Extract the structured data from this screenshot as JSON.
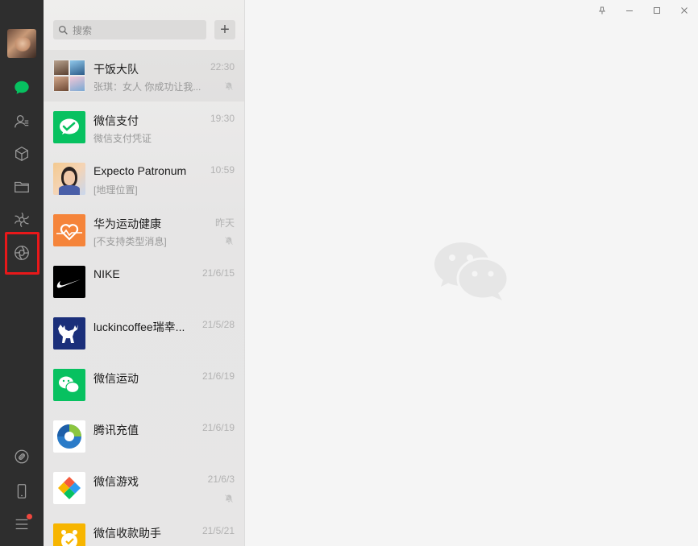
{
  "search": {
    "placeholder": "搜索",
    "add_label": "+"
  },
  "nav": {
    "items": [
      {
        "icon": "chat-bubble-icon",
        "active": true
      },
      {
        "icon": "contacts-icon"
      },
      {
        "icon": "cube-icon"
      },
      {
        "icon": "folder-icon"
      },
      {
        "icon": "moments-icon"
      },
      {
        "icon": "shutter-icon",
        "highlighted": true
      },
      {
        "icon": "link-icon"
      },
      {
        "icon": "phone-icon"
      },
      {
        "icon": "menu-icon",
        "badge": true
      }
    ]
  },
  "chats": [
    {
      "name": "干饭大队",
      "preview": "张琪：女人 你成功让我...",
      "time": "22:30",
      "muted": true,
      "avatar": "group-avatar"
    },
    {
      "name": "微信支付",
      "preview": "微信支付凭证",
      "time": "19:30",
      "muted": false,
      "avatar": "wechat-pay-avatar"
    },
    {
      "name": "Expecto Patronum",
      "preview": "[地理位置]",
      "time": "10:59",
      "muted": false,
      "avatar": "person-avatar"
    },
    {
      "name": "华为运动健康",
      "preview": "[不支持类型消息]",
      "time": "昨天",
      "muted": true,
      "avatar": "huawei-health-avatar"
    },
    {
      "name": "NIKE",
      "preview": "",
      "time": "21/6/15",
      "muted": false,
      "avatar": "nike-avatar"
    },
    {
      "name": "luckincoffee瑞幸...",
      "preview": "",
      "time": "21/5/28",
      "muted": false,
      "avatar": "luckin-avatar"
    },
    {
      "name": "微信运动",
      "preview": "",
      "time": "21/6/19",
      "muted": false,
      "avatar": "wechat-sport-avatar"
    },
    {
      "name": "腾讯充值",
      "preview": "",
      "time": "21/6/19",
      "muted": false,
      "avatar": "tencent-recharge-avatar"
    },
    {
      "name": "微信游戏",
      "preview": "",
      "time": "21/6/3",
      "muted": true,
      "avatar": "wechat-game-avatar"
    },
    {
      "name": "微信收款助手",
      "preview": "",
      "time": "21/5/21",
      "muted": false,
      "avatar": "payment-assistant-avatar"
    }
  ],
  "colors": {
    "rail": "#2e2e2e",
    "wechat_green": "#07c160",
    "highlight_red": "#e8181a"
  }
}
